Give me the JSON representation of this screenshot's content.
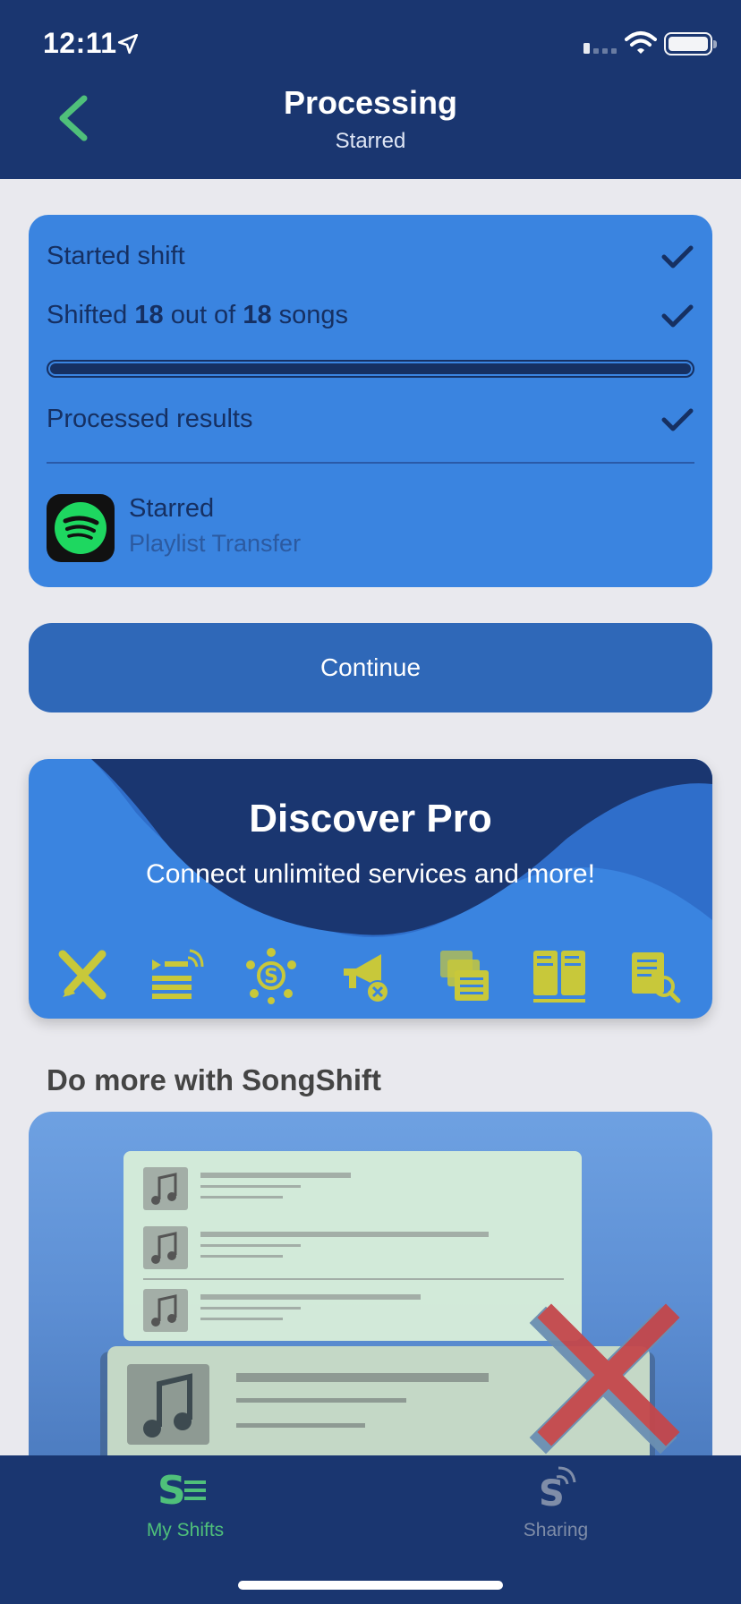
{
  "status": {
    "time": "12:11"
  },
  "nav": {
    "title": "Processing",
    "subtitle": "Starred"
  },
  "progress": {
    "started_label": "Started shift",
    "shifted_prefix": "Shifted",
    "shifted_done": "18",
    "shifted_mid": "out of",
    "shifted_total": "18",
    "shifted_suffix": "songs",
    "fraction": 1.0,
    "processed_label": "Processed results",
    "playlist_name": "Starred",
    "playlist_type": "Playlist Transfer"
  },
  "continue_label": "Continue",
  "promo": {
    "title": "Discover Pro",
    "subtitle": "Connect unlimited services and more!",
    "feature_icons": [
      "edit-icon",
      "playlist-sync-icon",
      "service-hub-icon",
      "megaphone-mute-icon",
      "multi-playlist-icon",
      "export-json-txt-icon",
      "search-list-icon"
    ]
  },
  "more": {
    "title": "Do more with SongShift"
  },
  "tabs": [
    {
      "label": "My Shifts",
      "active": true
    },
    {
      "label": "Sharing",
      "active": false
    }
  ],
  "colors": {
    "nav_bg": "#1a3670",
    "card_bg": "#3a84e0",
    "active_tab": "#4fc07a",
    "inactive_tab": "#7f8da8",
    "accent_yellow": "#c8c83a",
    "spotify_green": "#1ed760"
  }
}
